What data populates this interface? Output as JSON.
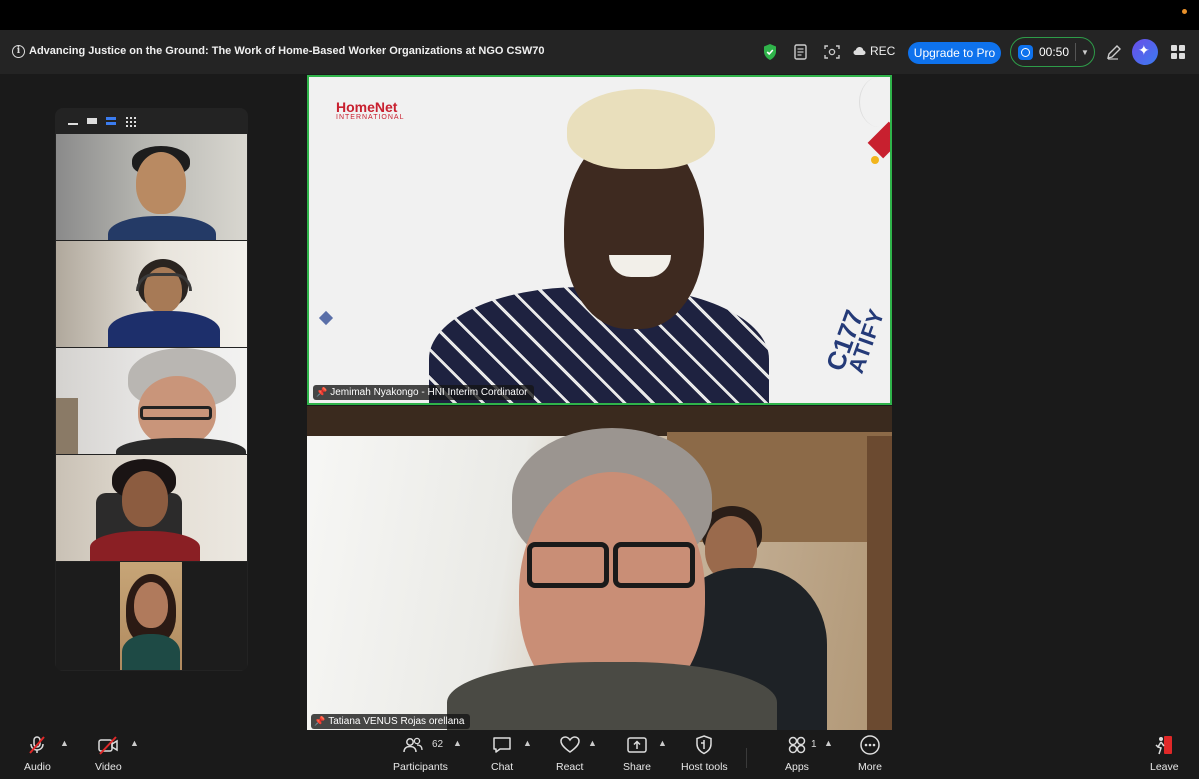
{
  "meeting": {
    "title": "Advancing Justice on the Ground: The Work of Home-Based Worker Organizations at NGO CSW70"
  },
  "header": {
    "rec_label": "REC",
    "upgrade_label": "Upgrade to Pro",
    "timer": "00:50"
  },
  "main_video": {
    "participant_name": "Jemimah Nyakongo - HNI Interim Cordinator",
    "background_logo": "HomeNet",
    "background_logo_sub": "INTERNATIONAL",
    "background_text_1": "ATIFY",
    "background_text_2": "C177"
  },
  "second_video": {
    "participant_name": "Tatiana VENUS Rojas orellana"
  },
  "gallery": {
    "tiles": [
      "participant-1",
      "participant-2",
      "participant-3",
      "participant-4",
      "participant-5"
    ]
  },
  "toolbar": {
    "audio_label": "Audio",
    "video_label": "Video",
    "participants_label": "Participants",
    "participants_count": "62",
    "chat_label": "Chat",
    "react_label": "React",
    "share_label": "Share",
    "host_tools_label": "Host tools",
    "apps_label": "Apps",
    "apps_count": "1",
    "more_label": "More",
    "leave_label": "Leave"
  },
  "colors": {
    "active_speaker_border": "#2fb34a",
    "upgrade_button": "#0e72ed",
    "leave_red": "#e02828",
    "mute_red": "#e02828",
    "homenet_red": "#c8202f"
  }
}
